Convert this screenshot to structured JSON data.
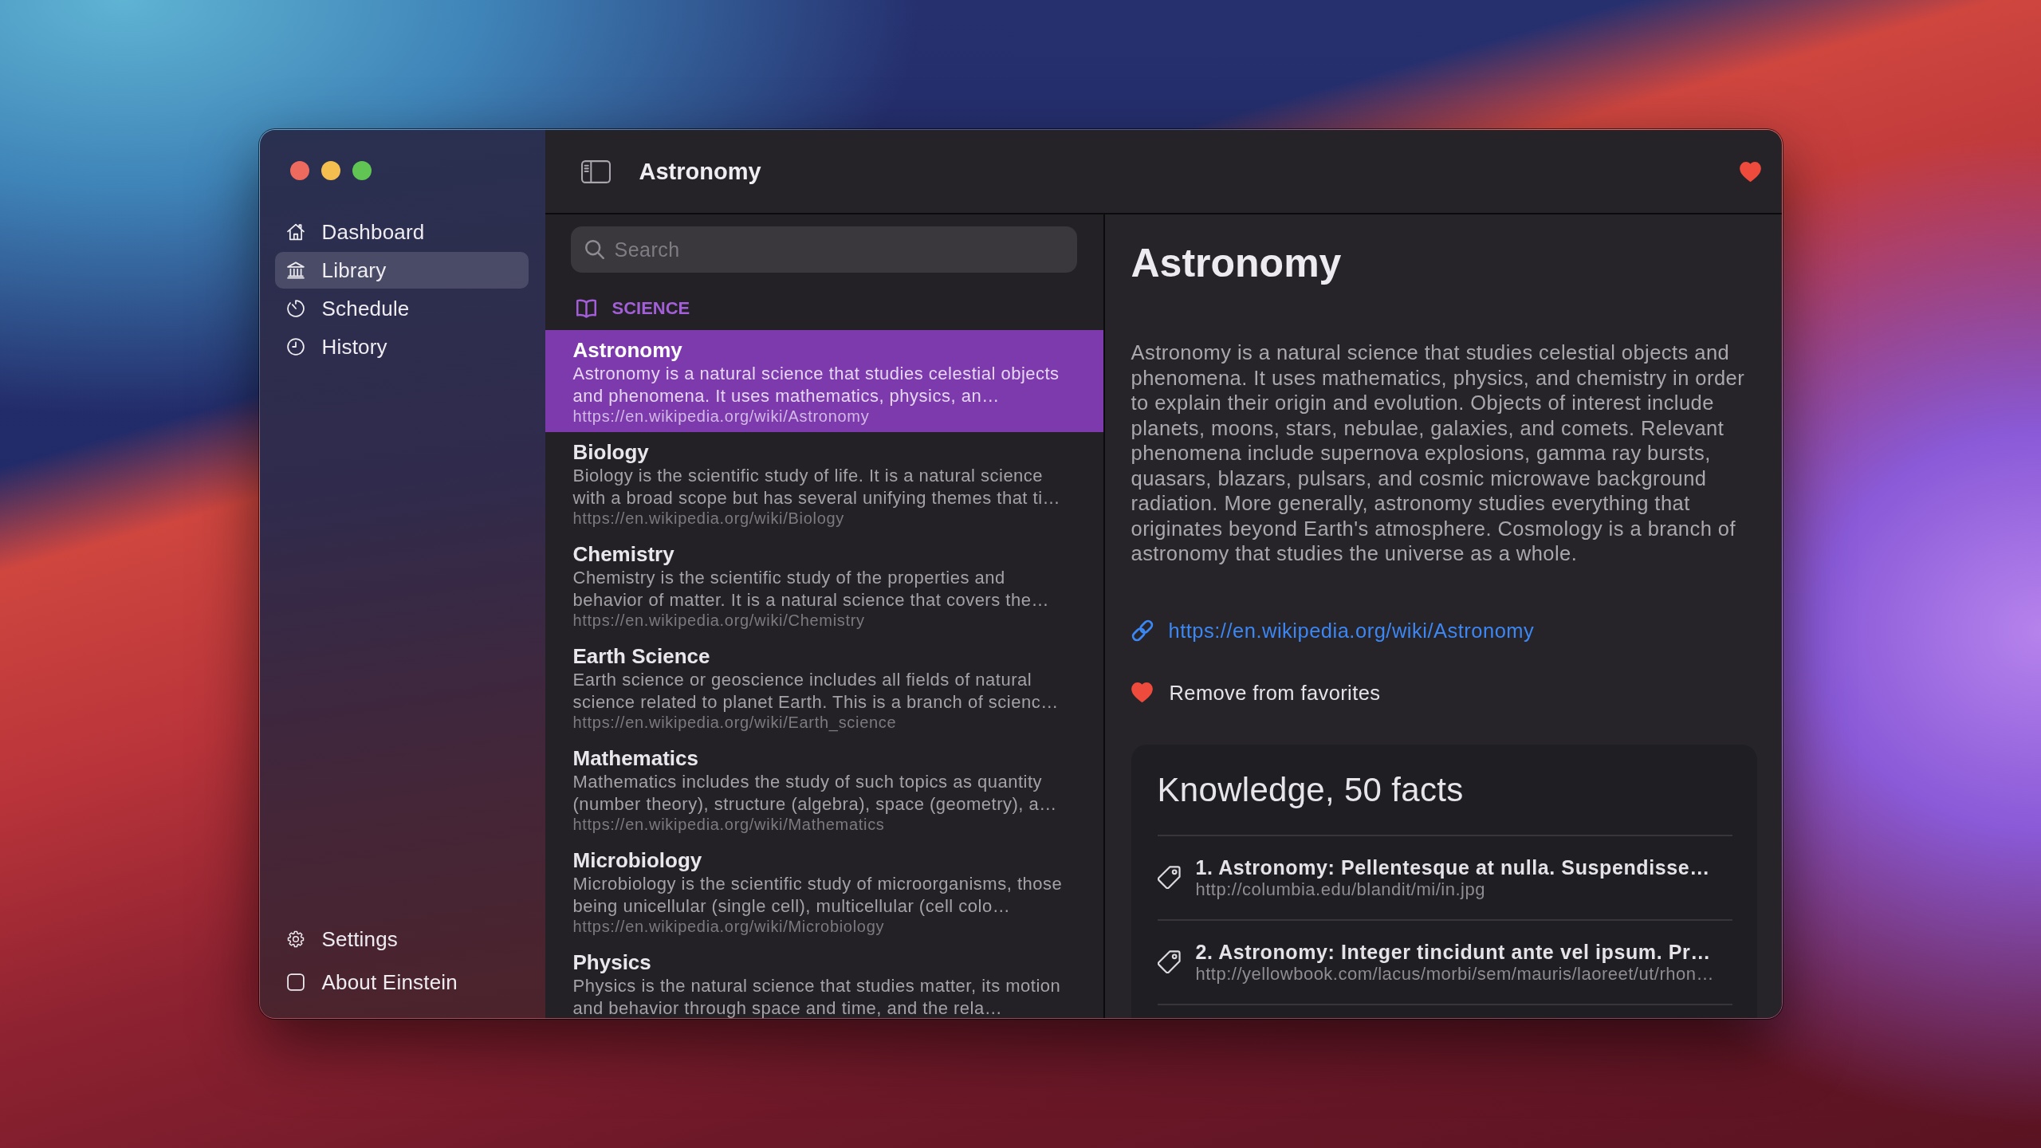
{
  "sidebar": {
    "items": [
      {
        "label": "Dashboard",
        "selected": false
      },
      {
        "label": "Library",
        "selected": true
      },
      {
        "label": "Schedule",
        "selected": false
      },
      {
        "label": "History",
        "selected": false
      }
    ],
    "footer_items": [
      {
        "label": "Settings"
      },
      {
        "label": "About Einstein"
      }
    ]
  },
  "toolbar": {
    "title": "Astronomy",
    "favorite": true
  },
  "search": {
    "placeholder": "Search"
  },
  "list": {
    "section": "SCIENCE",
    "items": [
      {
        "title": "Astronomy",
        "description": "Astronomy is a natural science that studies celestial objects and phenomena. It uses mathematics, physics, an…",
        "url": "https://en.wikipedia.org/wiki/Astronomy",
        "selected": true
      },
      {
        "title": "Biology",
        "description": "Biology is the scientific study of life. It is a natural science with a broad scope but has several unifying themes that ti…",
        "url": "https://en.wikipedia.org/wiki/Biology",
        "selected": false
      },
      {
        "title": "Chemistry",
        "description": "Chemistry is the scientific study of the properties and behavior of matter. It is a natural science that covers the…",
        "url": "https://en.wikipedia.org/wiki/Chemistry",
        "selected": false
      },
      {
        "title": "Earth Science",
        "description": "Earth science or geoscience includes all fields of natural science related to planet Earth. This is a branch of scienc…",
        "url": "https://en.wikipedia.org/wiki/Earth_science",
        "selected": false
      },
      {
        "title": "Mathematics",
        "description": "Mathematics includes the study of such topics as quantity (number theory), structure (algebra), space (geometry), a…",
        "url": "https://en.wikipedia.org/wiki/Mathematics",
        "selected": false
      },
      {
        "title": "Microbiology",
        "description": "Microbiology is the scientific study of microorganisms, those being unicellular (single cell), multicellular (cell colo…",
        "url": "https://en.wikipedia.org/wiki/Microbiology",
        "selected": false
      },
      {
        "title": "Physics",
        "description": "Physics is the natural science that studies matter, its motion and behavior through space and time, and the rela…",
        "selected": false
      }
    ]
  },
  "detail": {
    "title": "Astronomy",
    "summary": "Astronomy is a natural science that studies celestial objects and phenomena. It uses mathematics, physics, and chemistry in order to explain their origin and evolution. Objects of interest include planets, moons, stars, nebulae, galaxies, and comets. Relevant phenomena include supernova explosions, gamma ray bursts, quasars, blazars, pulsars, and cosmic microwave background radiation. More generally, astronomy studies everything that originates beyond Earth's atmosphere. Cosmology is a branch of astronomy that studies the universe as a whole.",
    "link": "https://en.wikipedia.org/wiki/Astronomy",
    "favorite_toggle": {
      "label": "Remove from favorites",
      "favorite": true
    },
    "knowledge": {
      "title": "Knowledge, 50 facts",
      "facts": [
        {
          "title": "1. Astronomy: Pellentesque at nulla. Suspendisse…",
          "url": "http://columbia.edu/blandit/mi/in.jpg"
        },
        {
          "title": "2. Astronomy: Integer tincidunt ante vel ipsum. Pr…",
          "url": "http://yellowbook.com/lacus/morbi/sem/mauris/laoreet/ut/rhon…"
        }
      ]
    }
  }
}
